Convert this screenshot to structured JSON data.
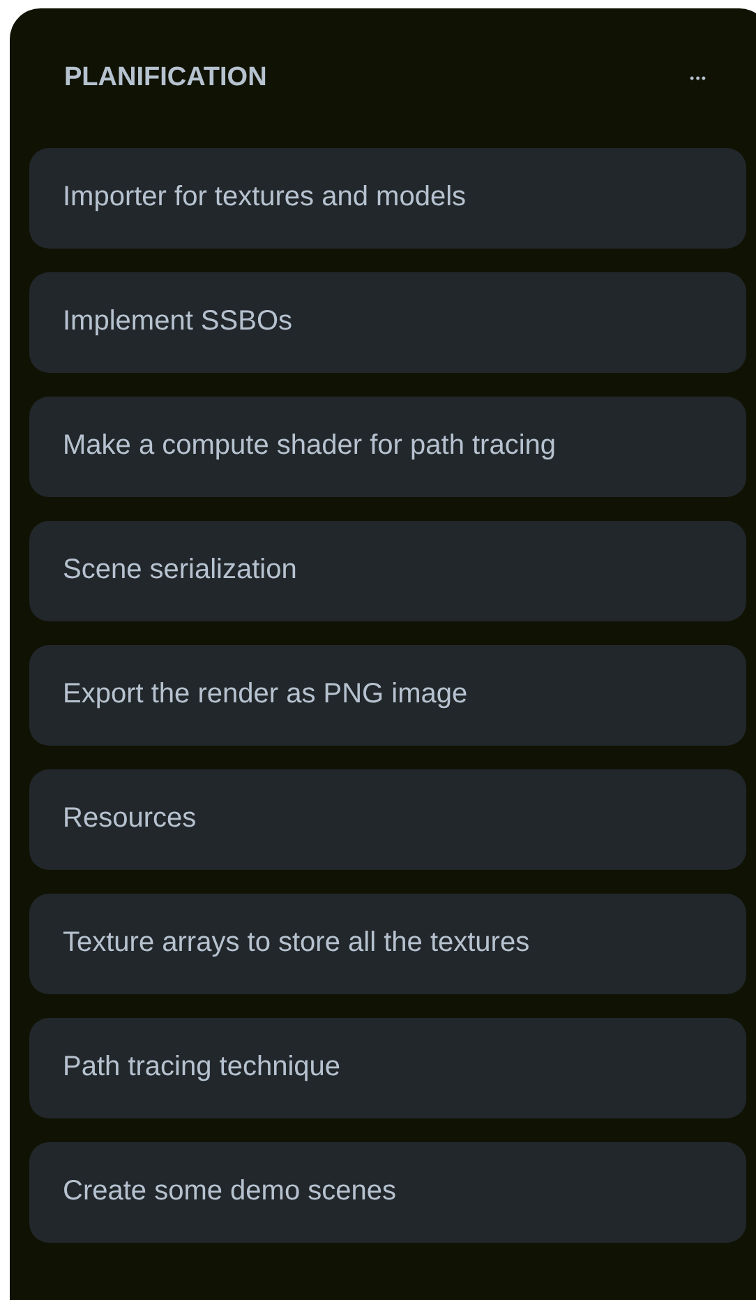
{
  "list": {
    "title": "PLANIFICATION",
    "menu": "•••",
    "cards": [
      {
        "title": "Importer for textures and models"
      },
      {
        "title": "Implement SSBOs"
      },
      {
        "title": "Make a compute shader for path tracing"
      },
      {
        "title": "Scene serialization"
      },
      {
        "title": "Export the render as PNG image"
      },
      {
        "title": "Resources"
      },
      {
        "title": "Texture arrays to store all the textures"
      },
      {
        "title": "Path tracing technique"
      },
      {
        "title": "Create some demo scenes"
      }
    ]
  }
}
